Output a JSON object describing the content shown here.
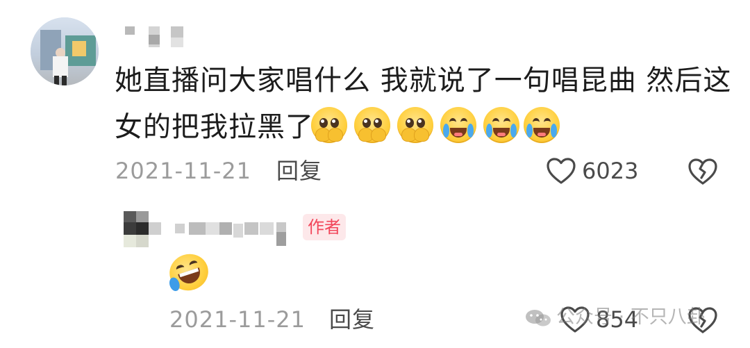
{
  "comment": {
    "username": "",
    "text_line1": "她直播问大家唱什么 我就说了一句唱昆曲 然后这",
    "text_line2": "女的把我拉黑了",
    "emojis": [
      "cover-mouth-tears-emoji",
      "cover-mouth-tears-emoji",
      "cover-mouth-tears-emoji",
      "crying-laughing-emoji",
      "crying-laughing-emoji",
      "crying-laughing-emoji"
    ],
    "date": "2021-11-21",
    "reply_label": "回复",
    "like_count": "6023",
    "like_icon": "heart-outline-icon",
    "dislike_icon": "broken-heart-icon"
  },
  "reply": {
    "username": "",
    "author_badge": "作者",
    "emoji": "rolling-on-floor-laughing-emoji",
    "date": "2021-11-21",
    "reply_label": "回复",
    "like_count": "854",
    "like_icon": "heart-outline-icon",
    "dislike_icon": "broken-heart-icon"
  },
  "watermark": {
    "text": "公众号 · 不只八卦",
    "icon": "wechat-icon"
  },
  "colors": {
    "text": "#1c1c1c",
    "meta": "#9b9b9b",
    "badge_bg": "#fde8ea",
    "badge_text": "#f2465a"
  }
}
